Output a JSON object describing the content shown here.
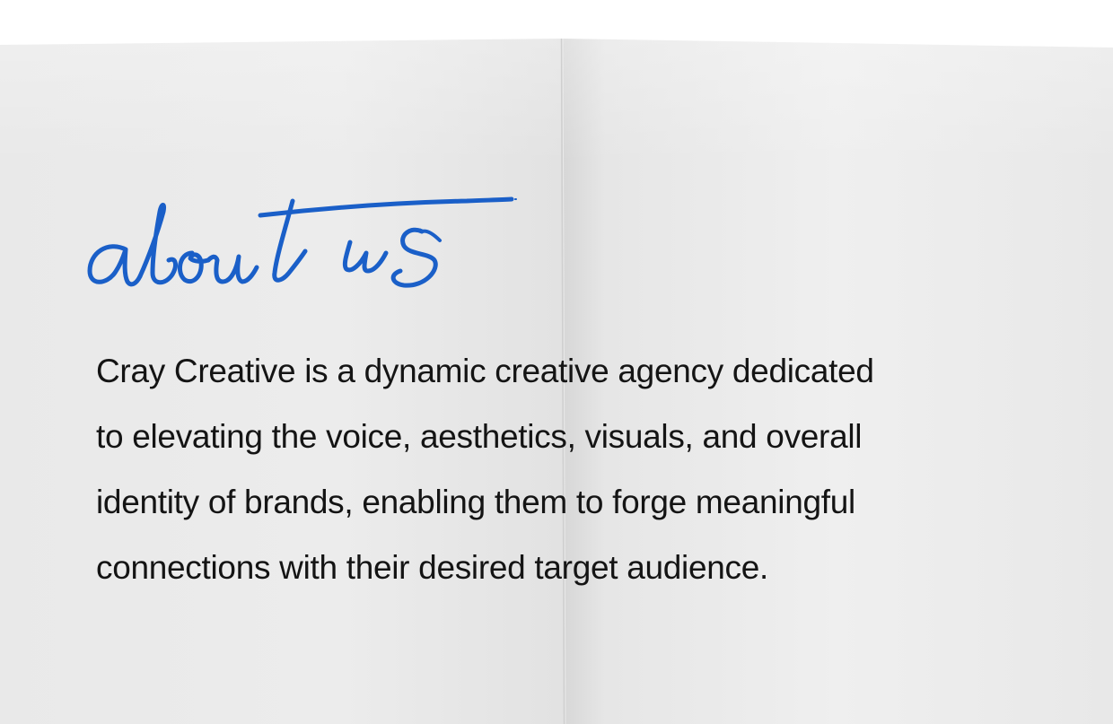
{
  "heading": {
    "text": "about us",
    "color": "#1a5fc8"
  },
  "body": {
    "lines": [
      "Cray Creative is a dynamic creative agency dedicated",
      "to elevating the voice, aesthetics, visuals, and overall",
      "identity of brands, enabling them to forge meaningful",
      "connections with their desired target audience."
    ]
  },
  "colors": {
    "paper": "#ececec",
    "text": "#141414",
    "accent": "#1a5fc8"
  }
}
